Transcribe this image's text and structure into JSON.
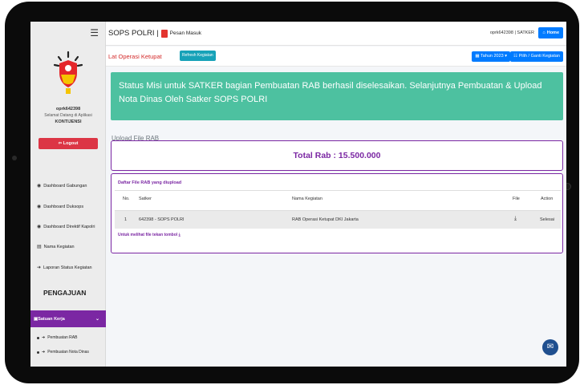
{
  "app": {
    "title": "SOPS POLRI |",
    "inbox_label": "Pesan Masuk",
    "user_top": "oprk642398 | SATKER",
    "home_label": "Home"
  },
  "sidebar": {
    "menu_icon": "hamburger-icon",
    "user_name": "oprk642398",
    "welcome": "Selamat Datang di Aplikasi",
    "org": "KONTIJENSI",
    "logout_label": "Logout",
    "items": [
      {
        "icon": "dashboard-icon",
        "label": "Dashboard Gabungan"
      },
      {
        "icon": "dashboard-icon",
        "label": "Dashboard Duksops"
      },
      {
        "icon": "dashboard-icon",
        "label": "Dashboard Direktif Kapolri"
      },
      {
        "icon": "list-icon",
        "label": "Nama Kegiatan"
      },
      {
        "icon": "arrow-icon",
        "label": "Laporan Status Kegiatan"
      }
    ],
    "section_title": "PENGAJUAN",
    "group": {
      "label": "Satuan Kerja",
      "icon": "folder-icon"
    },
    "sub_items": [
      {
        "label": "Pembuatan RAB"
      },
      {
        "label": "Pembuatan Nota Dinas"
      }
    ]
  },
  "header": {
    "lat_label": "Lat Operasi Ketupat",
    "refresh_label": "Refresh Kegiatan",
    "year_label": "Tahun 2023",
    "pilih_label": "Pilih / Ganti Kegiatan"
  },
  "main": {
    "status_message": "Status Misi untuk SATKER bagian Pembuatan RAB berhasil diselesaikan. Selanjutnya Pembuatan & Upload Nota Dinas Oleh Satker SOPS POLRI",
    "upload_title": "Upload File RAB",
    "total_label": "Total Rab : 15.500.000",
    "table_title": "Daftar File RAB yang diupload",
    "columns": [
      "No.",
      "Satker",
      "Nama Kegiatan",
      "File",
      "Action"
    ],
    "rows": [
      {
        "no": "1",
        "satker": "642398 - SOPS POLRI",
        "kegiatan": "RAB Operasi Ketupat DKI Jakarta",
        "file_icon": "download-icon",
        "action": "Selesai"
      }
    ],
    "note": "Untuk melihat file tekan tombol"
  },
  "colors": {
    "purple": "#7b27a3",
    "green": "#4dc1a0",
    "red": "#dc3545",
    "blue": "#007bff",
    "teal": "#17a2b8"
  }
}
